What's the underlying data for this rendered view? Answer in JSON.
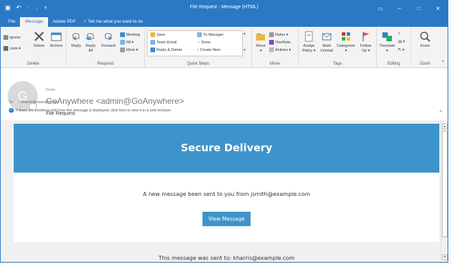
{
  "titlebar": {
    "title": "File Request - Message (HTML)",
    "qat": {
      "save_icon": "floppy-icon",
      "undo_icon": "undo-icon",
      "redo_icon": "redo-icon"
    }
  },
  "tabs": [
    {
      "label": "File"
    },
    {
      "label": "Message"
    },
    {
      "label": "Adobe PDF"
    }
  ],
  "tellme": "Tell me what you want to do",
  "ribbon": {
    "delete_group": {
      "label": "Delete",
      "ignore": "Ignore",
      "junk": "Junk",
      "delete": "Delete",
      "archive": "Archive"
    },
    "respond_group": {
      "label": "Respond",
      "reply": "Reply",
      "reply_all_1": "Reply",
      "reply_all_2": "All",
      "forward": "Forward",
      "meeting": "Meeting",
      "im": "IM",
      "more": "More"
    },
    "quicksteps_group": {
      "label": "Quick Steps",
      "save": "Save",
      "team_email": "Team Email",
      "reply_delete": "Reply & Delete",
      "to_manager": "To Manager",
      "done": "Done",
      "create_new": "Create New"
    },
    "move_group": {
      "label": "Move",
      "move": "Move",
      "rules": "Rules",
      "onenote": "OneNote",
      "actions": "Actions"
    },
    "tags_group": {
      "label": "Tags",
      "assign_policy_1": "Assign",
      "assign_policy_2": "Policy",
      "mark_unread_1": "Mark",
      "mark_unread_2": "Unread",
      "categorize": "Categorize",
      "follow_up_1": "Follow",
      "follow_up_2": "Up"
    },
    "editing_group": {
      "label": "Editing",
      "translate": "Translate"
    },
    "zoom_group": {
      "label": "Zoom",
      "zoom": "Zoom"
    }
  },
  "header": {
    "avatar_initial": "G",
    "from_label": "From",
    "sender": "GoAnywhere <admin@GoAnywhere>",
    "subject": "File Request",
    "to_label": "To",
    "recipient": "kharris@example.com",
    "info_text": "If there are problems with how this message is displayed, click here to view it in a web browser."
  },
  "message": {
    "banner_title": "Secure Delivery",
    "notice": "A new message been sent to you from jsmith@example.com",
    "button_label": "View Message",
    "footer_text": "This message was sent to: kharris@example.com"
  },
  "colors": {
    "accent": "#2b78c5",
    "banner": "#3d94cb"
  }
}
